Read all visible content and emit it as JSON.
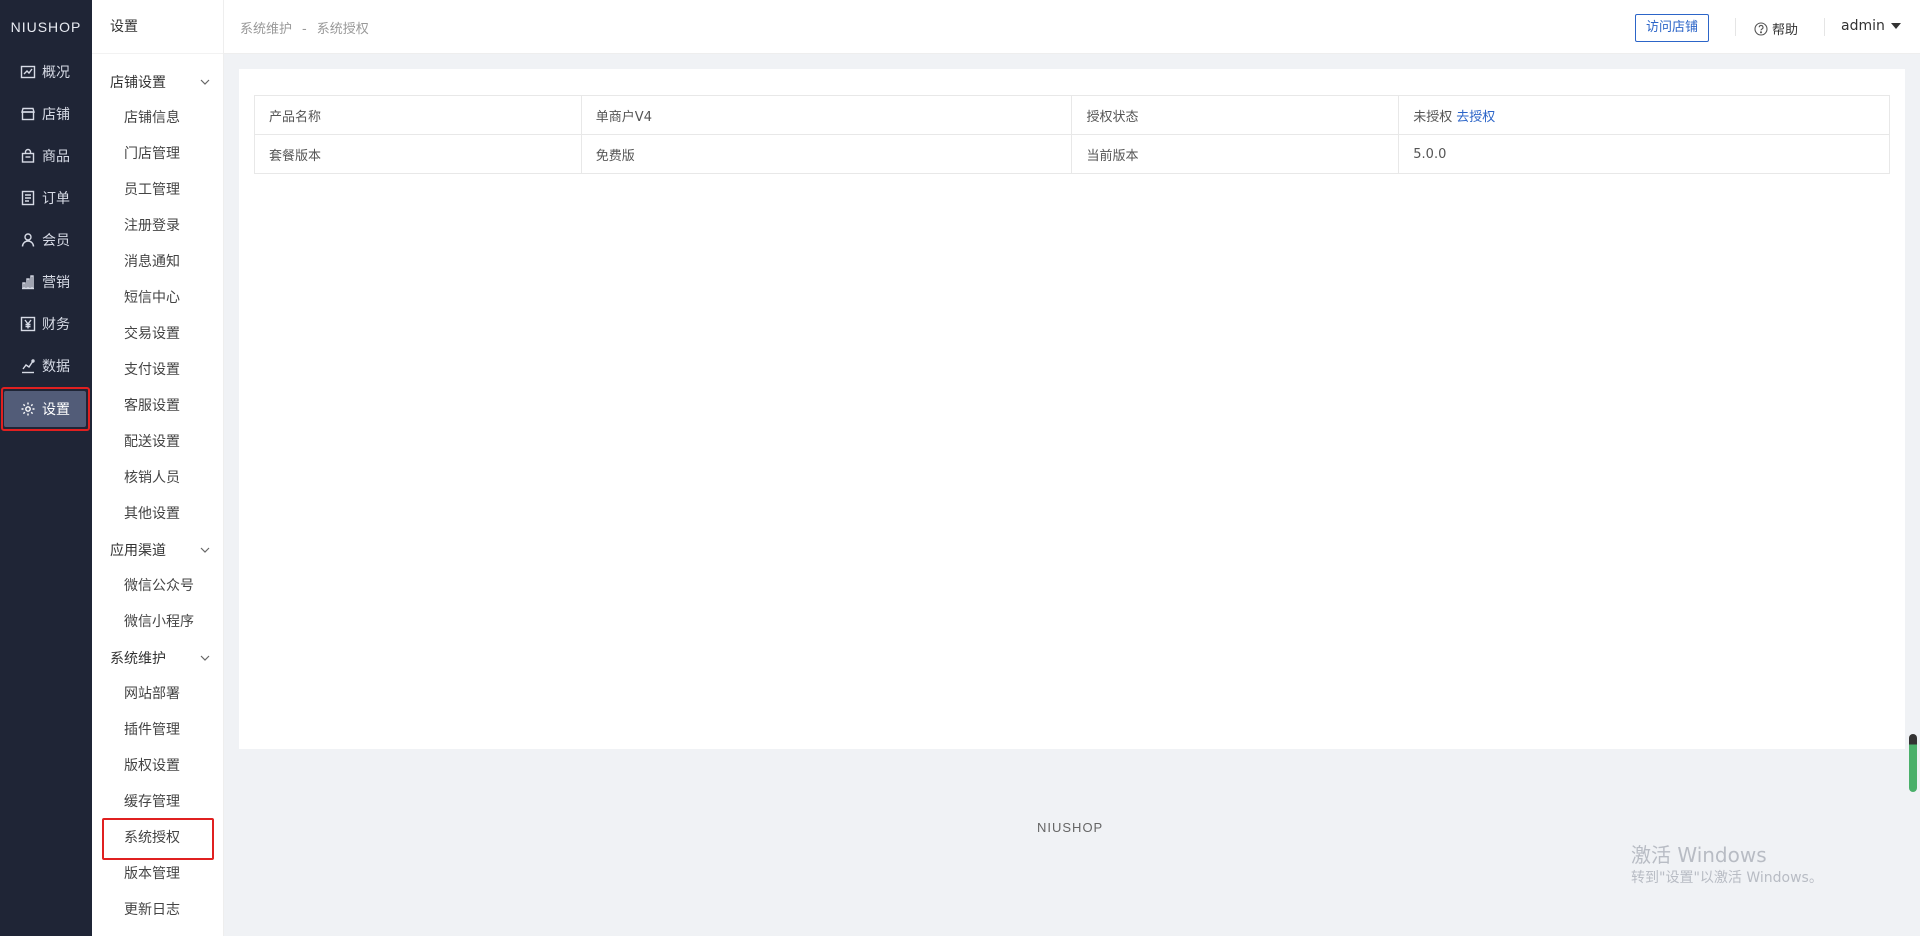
{
  "brand": {
    "logo_text": "NIUSHOP",
    "footer_logo": "NIUSHOP"
  },
  "rail": {
    "items": [
      {
        "label": "概况",
        "icon": "line-chart-icon"
      },
      {
        "label": "店铺",
        "icon": "shop-icon"
      },
      {
        "label": "商品",
        "icon": "bag-icon"
      },
      {
        "label": "订单",
        "icon": "order-list-icon"
      },
      {
        "label": "会员",
        "icon": "user-icon"
      },
      {
        "label": "营销",
        "icon": "bar-chart-icon"
      },
      {
        "label": "财务",
        "icon": "yen-icon"
      },
      {
        "label": "数据",
        "icon": "data-chart-icon"
      },
      {
        "label": "设置",
        "icon": "gear-icon",
        "active": true
      }
    ]
  },
  "submenu": {
    "title": "设置",
    "groups": [
      {
        "label": "店铺设置",
        "items": [
          "店铺信息",
          "门店管理",
          "员工管理",
          "注册登录",
          "消息通知",
          "短信中心",
          "交易设置",
          "支付设置",
          "客服设置",
          "配送设置",
          "核销人员",
          "其他设置"
        ]
      },
      {
        "label": "应用渠道",
        "items": [
          "微信公众号",
          "微信小程序"
        ]
      },
      {
        "label": "系统维护",
        "items": [
          "网站部署",
          "插件管理",
          "版权设置",
          "缓存管理",
          "系统授权",
          "版本管理",
          "更新日志"
        ]
      }
    ],
    "selected": "系统授权"
  },
  "topbar": {
    "breadcrumb": [
      "系统维护",
      "系统授权"
    ],
    "breadcrumb_sep": "-",
    "visit_store": "访问店铺",
    "help": "帮助",
    "user": "admin"
  },
  "auth_table": {
    "rows": [
      {
        "k1": "产品名称",
        "v1": "单商户V4",
        "k2": "授权状态",
        "v2": "未授权",
        "v2_link": "去授权"
      },
      {
        "k1": "套餐版本",
        "v1": "免费版",
        "k2": "当前版本",
        "v2": "5.0.0"
      }
    ]
  },
  "watermark": {
    "title": "激活 Windows",
    "subtitle": "转到\"设置\"以激活 Windows。"
  },
  "colors": {
    "rail_bg": "#1f2536",
    "accent": "#2c65c8",
    "highlight": "#e02020"
  }
}
